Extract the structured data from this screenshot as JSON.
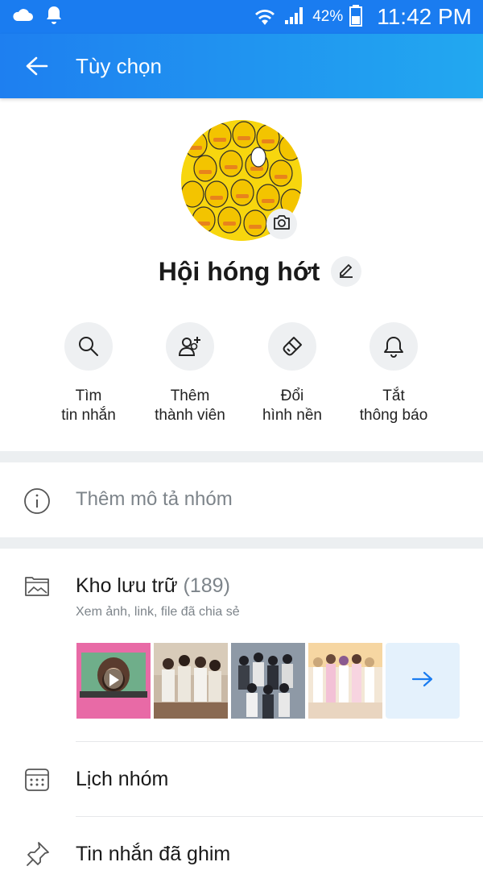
{
  "status_bar": {
    "battery_percent": "42%",
    "time": "11:42 PM",
    "icons": [
      "cloud-icon",
      "notification-bell-icon",
      "wifi-icon",
      "signal-icon",
      "battery-icon"
    ]
  },
  "header": {
    "title": "Tùy chọn",
    "back_icon": "arrow-left-icon"
  },
  "profile": {
    "group_name": "Hội hóng hớt",
    "camera_icon": "camera-icon",
    "edit_icon": "pencil-icon"
  },
  "actions": [
    {
      "label": "Tìm\ntin nhắn",
      "icon": "search-icon"
    },
    {
      "label": "Thêm\nthành viên",
      "icon": "add-member-icon"
    },
    {
      "label": "Đổi\nhình nền",
      "icon": "paint-brush-icon"
    },
    {
      "label": "Tắt\nthông báo",
      "icon": "bell-icon"
    }
  ],
  "description": {
    "label": "Thêm mô tả nhóm",
    "icon": "info-icon"
  },
  "storage": {
    "title": "Kho lưu trữ",
    "count": "(189)",
    "subtitle": "Xem ảnh, link, file đã chia sẻ",
    "icon": "gallery-icon",
    "more_icon": "arrow-right-icon",
    "accent_color": "#1a7cf0"
  },
  "menu": [
    {
      "label": "Lịch nhóm",
      "icon": "calendar-icon"
    },
    {
      "label": "Tin nhắn đã ghim",
      "icon": "pin-icon"
    }
  ],
  "colors": {
    "header_start": "#1e7ff0",
    "header_end": "#22a8f0",
    "accent": "#1a7cf0",
    "muted_text": "#7d848a",
    "divider": "#eceff1"
  }
}
